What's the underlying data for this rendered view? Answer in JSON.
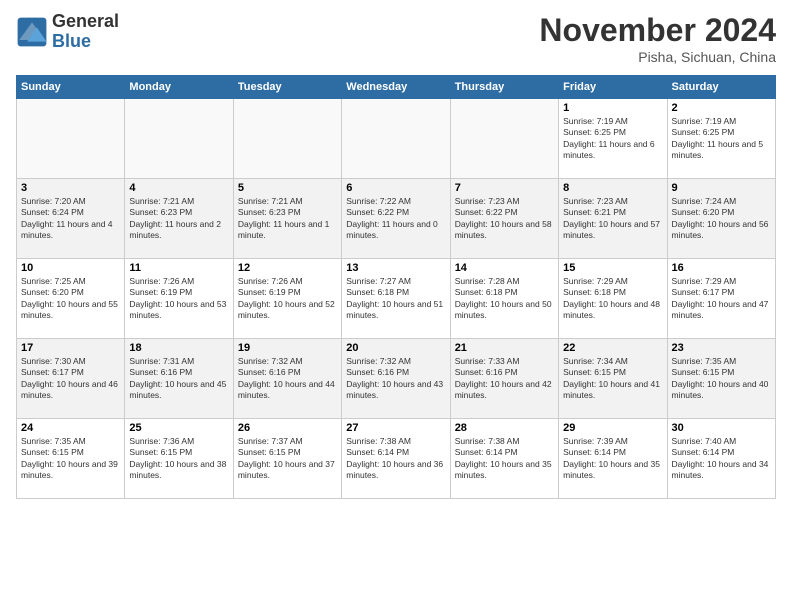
{
  "logo": {
    "general": "General",
    "blue": "Blue"
  },
  "title": "November 2024",
  "location": "Pisha, Sichuan, China",
  "days_of_week": [
    "Sunday",
    "Monday",
    "Tuesday",
    "Wednesday",
    "Thursday",
    "Friday",
    "Saturday"
  ],
  "weeks": [
    {
      "days": [
        {
          "num": "",
          "info": ""
        },
        {
          "num": "",
          "info": ""
        },
        {
          "num": "",
          "info": ""
        },
        {
          "num": "",
          "info": ""
        },
        {
          "num": "",
          "info": ""
        },
        {
          "num": "1",
          "info": "Sunrise: 7:19 AM\nSunset: 6:25 PM\nDaylight: 11 hours and 6 minutes."
        },
        {
          "num": "2",
          "info": "Sunrise: 7:19 AM\nSunset: 6:25 PM\nDaylight: 11 hours and 5 minutes."
        }
      ]
    },
    {
      "days": [
        {
          "num": "3",
          "info": "Sunrise: 7:20 AM\nSunset: 6:24 PM\nDaylight: 11 hours and 4 minutes."
        },
        {
          "num": "4",
          "info": "Sunrise: 7:21 AM\nSunset: 6:23 PM\nDaylight: 11 hours and 2 minutes."
        },
        {
          "num": "5",
          "info": "Sunrise: 7:21 AM\nSunset: 6:23 PM\nDaylight: 11 hours and 1 minute."
        },
        {
          "num": "6",
          "info": "Sunrise: 7:22 AM\nSunset: 6:22 PM\nDaylight: 11 hours and 0 minutes."
        },
        {
          "num": "7",
          "info": "Sunrise: 7:23 AM\nSunset: 6:22 PM\nDaylight: 10 hours and 58 minutes."
        },
        {
          "num": "8",
          "info": "Sunrise: 7:23 AM\nSunset: 6:21 PM\nDaylight: 10 hours and 57 minutes."
        },
        {
          "num": "9",
          "info": "Sunrise: 7:24 AM\nSunset: 6:20 PM\nDaylight: 10 hours and 56 minutes."
        }
      ]
    },
    {
      "days": [
        {
          "num": "10",
          "info": "Sunrise: 7:25 AM\nSunset: 6:20 PM\nDaylight: 10 hours and 55 minutes."
        },
        {
          "num": "11",
          "info": "Sunrise: 7:26 AM\nSunset: 6:19 PM\nDaylight: 10 hours and 53 minutes."
        },
        {
          "num": "12",
          "info": "Sunrise: 7:26 AM\nSunset: 6:19 PM\nDaylight: 10 hours and 52 minutes."
        },
        {
          "num": "13",
          "info": "Sunrise: 7:27 AM\nSunset: 6:18 PM\nDaylight: 10 hours and 51 minutes."
        },
        {
          "num": "14",
          "info": "Sunrise: 7:28 AM\nSunset: 6:18 PM\nDaylight: 10 hours and 50 minutes."
        },
        {
          "num": "15",
          "info": "Sunrise: 7:29 AM\nSunset: 6:18 PM\nDaylight: 10 hours and 48 minutes."
        },
        {
          "num": "16",
          "info": "Sunrise: 7:29 AM\nSunset: 6:17 PM\nDaylight: 10 hours and 47 minutes."
        }
      ]
    },
    {
      "days": [
        {
          "num": "17",
          "info": "Sunrise: 7:30 AM\nSunset: 6:17 PM\nDaylight: 10 hours and 46 minutes."
        },
        {
          "num": "18",
          "info": "Sunrise: 7:31 AM\nSunset: 6:16 PM\nDaylight: 10 hours and 45 minutes."
        },
        {
          "num": "19",
          "info": "Sunrise: 7:32 AM\nSunset: 6:16 PM\nDaylight: 10 hours and 44 minutes."
        },
        {
          "num": "20",
          "info": "Sunrise: 7:32 AM\nSunset: 6:16 PM\nDaylight: 10 hours and 43 minutes."
        },
        {
          "num": "21",
          "info": "Sunrise: 7:33 AM\nSunset: 6:16 PM\nDaylight: 10 hours and 42 minutes."
        },
        {
          "num": "22",
          "info": "Sunrise: 7:34 AM\nSunset: 6:15 PM\nDaylight: 10 hours and 41 minutes."
        },
        {
          "num": "23",
          "info": "Sunrise: 7:35 AM\nSunset: 6:15 PM\nDaylight: 10 hours and 40 minutes."
        }
      ]
    },
    {
      "days": [
        {
          "num": "24",
          "info": "Sunrise: 7:35 AM\nSunset: 6:15 PM\nDaylight: 10 hours and 39 minutes."
        },
        {
          "num": "25",
          "info": "Sunrise: 7:36 AM\nSunset: 6:15 PM\nDaylight: 10 hours and 38 minutes."
        },
        {
          "num": "26",
          "info": "Sunrise: 7:37 AM\nSunset: 6:15 PM\nDaylight: 10 hours and 37 minutes."
        },
        {
          "num": "27",
          "info": "Sunrise: 7:38 AM\nSunset: 6:14 PM\nDaylight: 10 hours and 36 minutes."
        },
        {
          "num": "28",
          "info": "Sunrise: 7:38 AM\nSunset: 6:14 PM\nDaylight: 10 hours and 35 minutes."
        },
        {
          "num": "29",
          "info": "Sunrise: 7:39 AM\nSunset: 6:14 PM\nDaylight: 10 hours and 35 minutes."
        },
        {
          "num": "30",
          "info": "Sunrise: 7:40 AM\nSunset: 6:14 PM\nDaylight: 10 hours and 34 minutes."
        }
      ]
    }
  ]
}
